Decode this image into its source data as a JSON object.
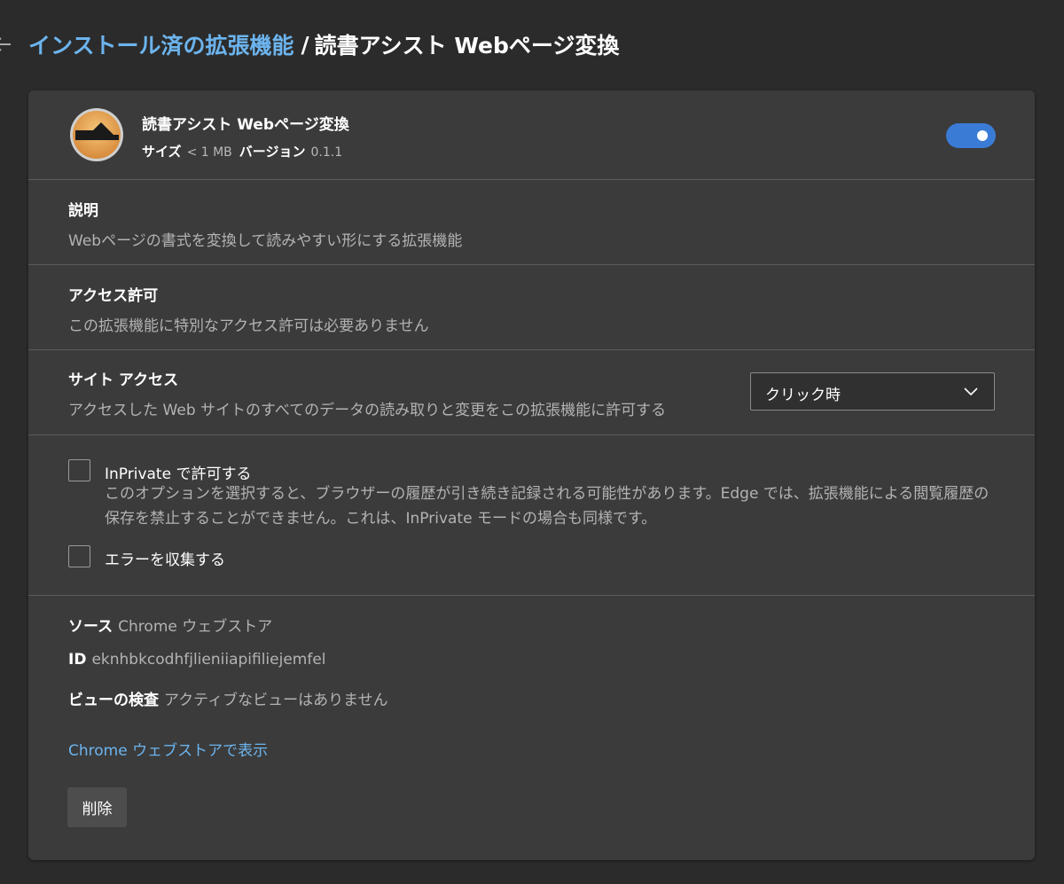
{
  "header": {
    "back_icon": "arrow-left-icon",
    "breadcrumb_parent": "インストール済の拡張機能",
    "breadcrumb_separator": "/",
    "breadcrumb_current": "読書アシスト Webページ変換"
  },
  "extension": {
    "icon": "extension-logo",
    "name": "読書アシスト Webページ変換",
    "size_label": "サイズ",
    "size_value": "< 1 MB",
    "version_label": "バージョン",
    "version_value": "0.1.1",
    "enabled": true
  },
  "description": {
    "title": "説明",
    "text": "Webページの書式を変換して読みやすい形にする拡張機能"
  },
  "permissions": {
    "title": "アクセス許可",
    "text": "この拡張機能に特別なアクセス許可は必要ありません"
  },
  "site_access": {
    "title": "サイト アクセス",
    "text": "アクセスした Web サイトのすべてのデータの読み取りと変更をこの拡張機能に許可する",
    "selected": "クリック時"
  },
  "options": {
    "inprivate_label": "InPrivate で許可する",
    "inprivate_desc": "このオプションを選択すると、ブラウザーの履歴が引き続き記録される可能性があります。Edge では、拡張機能による閲覧履歴の保存を禁止することができません。これは、InPrivate モードの場合も同様です。",
    "inprivate_checked": false,
    "errors_label": "エラーを収集する",
    "errors_checked": false
  },
  "details": {
    "source_label": "ソース",
    "source_value": "Chrome ウェブストア",
    "id_label": "ID",
    "id_value": "eknhbkcodhfjlieniiapifiliejemfel",
    "inspect_label": "ビューの検査",
    "inspect_value": "アクティブなビューはありません",
    "store_link": "Chrome ウェブストアで表示",
    "remove_button": "削除"
  },
  "colors": {
    "background": "#2b2b2b",
    "card": "#3b3b3b",
    "accent": "#3a7bd5",
    "link": "#6cb4ee",
    "secondary_text": "#b3b3b3"
  }
}
